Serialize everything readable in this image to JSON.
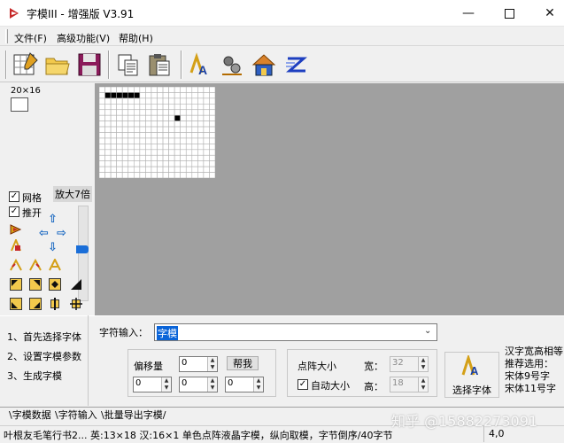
{
  "window": {
    "title": "字模III - 增强版 V3.91",
    "minimize_icon": "minimize-icon",
    "maximize_icon": "maximize-icon",
    "close_icon": "close-icon"
  },
  "menu": {
    "items": [
      "文件(F)",
      "高级功能(V)",
      "帮助(H)"
    ]
  },
  "toolbar": {
    "icons": [
      "new-grid-icon",
      "open-folder-icon",
      "save-disk-icon",
      "copy-icon",
      "paste-icon",
      "font-select-icon",
      "settings-gear-icon",
      "generate-house-icon",
      "export-z-icon"
    ]
  },
  "left_panel": {
    "preview_size": "20×16",
    "grid_label": "网格",
    "grid_checked": true,
    "push_label": "推开",
    "push_checked": true,
    "zoom_label": "放大7倍",
    "zoom_level_fraction": 0.42
  },
  "grid": {
    "cols": 20,
    "rows": 16,
    "filled": [
      [
        1,
        1
      ],
      [
        2,
        1
      ],
      [
        3,
        1
      ],
      [
        4,
        1
      ],
      [
        5,
        1
      ],
      [
        6,
        1
      ],
      [
        13,
        5
      ]
    ]
  },
  "steps": [
    "1、首先选择字体",
    "2、设置字模参数",
    "3、生成字模"
  ],
  "char_input": {
    "label": "字符输入：",
    "value": "字模"
  },
  "offset": {
    "label": "偏移量",
    "top_value": "0",
    "values": [
      "0",
      "0",
      "0"
    ],
    "button_label": "帮我"
  },
  "matrix_size": {
    "label": "点阵大小",
    "width_label": "宽：",
    "width_value": "32",
    "height_label": "高：",
    "height_value": "18",
    "auto_label": "自动大小",
    "auto_checked": true
  },
  "select_font_button": "选择字体",
  "hint": [
    "汉字宽高相等",
    "推荐选用：",
    "宋体9号字",
    "宋体11号字"
  ],
  "tabs": [
    "字模数据",
    "字符输入",
    "批量导出字模"
  ],
  "status": {
    "text": "叶根友毛笔行书2... 英:13×18 汉:16×1 单色点阵液晶字模，纵向取模，字节倒序/40字节",
    "position": "4,0"
  },
  "watermark": "知乎 @15882273091",
  "colors": {
    "accent": "#1a6ed8",
    "canvas_bg": "#a0a0a0"
  }
}
